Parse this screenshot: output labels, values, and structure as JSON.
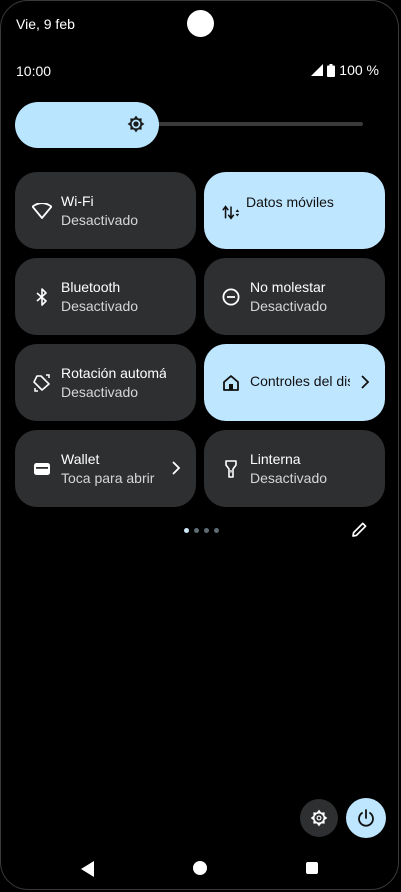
{
  "status": {
    "date": "Vie, 9 feb",
    "time": "10:00",
    "battery": "100 %"
  },
  "brightness": {
    "level": 0.33
  },
  "tiles": [
    {
      "title": "Wi-Fi",
      "subtitle": "Desactivado",
      "icon": "wifi-icon",
      "active": false
    },
    {
      "title": "Datos móviles",
      "subtitle": "",
      "icon": "mobile-data-icon",
      "active": true
    },
    {
      "title": "Bluetooth",
      "subtitle": "Desactivado",
      "icon": "bluetooth-icon",
      "active": false
    },
    {
      "title": "No molestar",
      "subtitle": "Desactivado",
      "icon": "do-not-disturb-icon",
      "active": false
    },
    {
      "title": "Rotación automática",
      "subtitle": "Desactivado",
      "icon": "auto-rotate-icon",
      "active": false
    },
    {
      "title": "Controles del dispositivo",
      "subtitle": "",
      "icon": "home-icon",
      "active": true
    },
    {
      "title": "Wallet",
      "subtitle": "Toca para abrir",
      "icon": "wallet-icon",
      "active": false
    },
    {
      "title": "Linterna",
      "subtitle": "Desactivado",
      "icon": "flashlight-icon",
      "active": false
    }
  ],
  "pager": {
    "pages": 4,
    "current": 1
  },
  "colors": {
    "active_tile": "#bfe6ff",
    "inactive_tile": "#2d2f31"
  }
}
